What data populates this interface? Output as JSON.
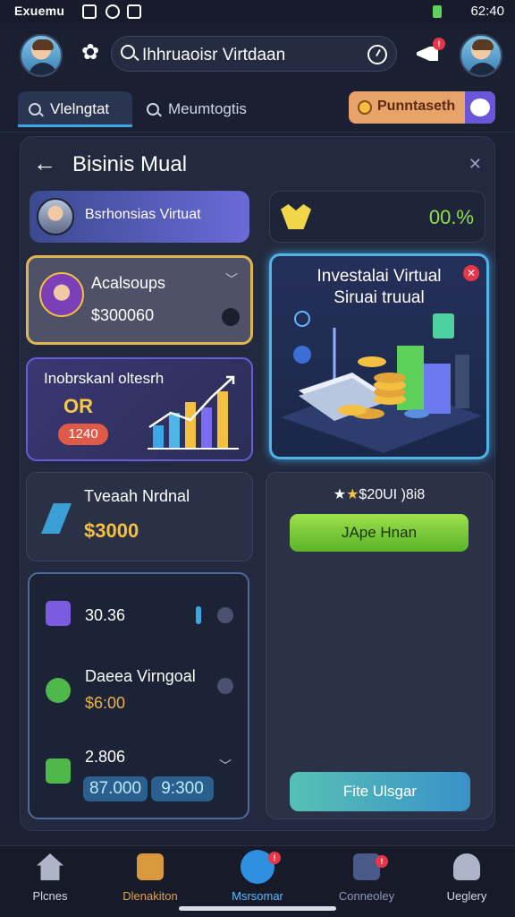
{
  "status_bar": {
    "left_text": "Exuemu",
    "time": "62:40"
  },
  "header": {
    "search_text": "Ihhruaoisr Virtdaan"
  },
  "tabs": [
    {
      "label": "Vlelngtat"
    },
    {
      "label": "Meumtogtis"
    }
  ],
  "promo": {
    "label": "Punntaseth"
  },
  "panel": {
    "title": "Bisinis Mual",
    "profile_name": "Bsrhonsias Virtuat",
    "rate": "00.%",
    "gold_card": {
      "title": "Acalsoups",
      "value": "$300060"
    },
    "chart_card": {
      "title": "Inobrskanl oltesrh",
      "or_text": "OR",
      "pill": "1240"
    },
    "invest_card": {
      "title_line1": "Investalai Virtual",
      "title_line2": "Siruai truual"
    },
    "nrd_card": {
      "title": "Tveaah Nrdnal",
      "value": "$3000"
    },
    "list_items": [
      {
        "text": "30.36"
      },
      {
        "text": "Daeea Virngoal",
        "sub": "$6:00"
      },
      {
        "text": "2.806"
      }
    ],
    "pills": [
      "87.000",
      "9:300"
    ],
    "right_card": {
      "stars_text": "$20UI )8i8",
      "green_button": "JApe Hnan",
      "teal_button": "Fite Ulsgar"
    }
  },
  "bottom_nav": [
    {
      "label": "Plcnes"
    },
    {
      "label": "Dlenakiton"
    },
    {
      "label": "Msrsomar"
    },
    {
      "label": "Conneoley"
    },
    {
      "label": "Ueglery"
    }
  ],
  "colors": {
    "accent_blue": "#39a7e0",
    "gold": "#f4c042",
    "green": "#8fe04c"
  }
}
